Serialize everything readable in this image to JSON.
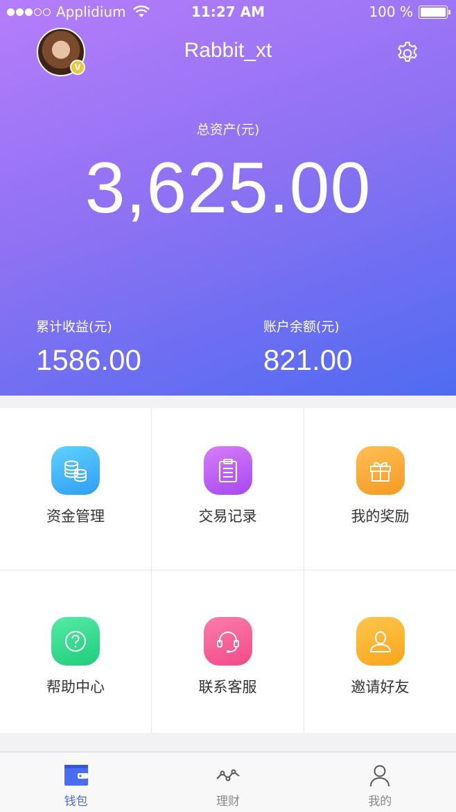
{
  "status_bar": {
    "carrier": "Applidium",
    "time": "11:27 AM",
    "battery": "100 %"
  },
  "header": {
    "username": "Rabbit_xt",
    "vip_badge": "V"
  },
  "assets": {
    "total_label": "总资产(元)",
    "total_value": "3,625.00",
    "earnings_label": "累计收益(元)",
    "earnings_value": "1586.00",
    "balance_label": "账户余额(元)",
    "balance_value": "821.00"
  },
  "menu": [
    {
      "label": "资金管理",
      "icon": "coins-icon",
      "color_from": "#5fd2fb",
      "color_to": "#2f9df6"
    },
    {
      "label": "交易记录",
      "icon": "clipboard-icon",
      "color_from": "#d77df9",
      "color_to": "#a648f0"
    },
    {
      "label": "我的奖励",
      "icon": "gift-icon",
      "color_from": "#ffbf55",
      "color_to": "#f59a22"
    },
    {
      "label": "帮助中心",
      "icon": "help-icon",
      "color_from": "#55eba6",
      "color_to": "#1dcd7a"
    },
    {
      "label": "联系客服",
      "icon": "headset-icon",
      "color_from": "#fb7dab",
      "color_to": "#f44a87"
    },
    {
      "label": "邀请好友",
      "icon": "user-icon",
      "color_from": "#ffc74d",
      "color_to": "#f8a41a"
    }
  ],
  "tabs": [
    {
      "label": "钱包",
      "icon": "wallet-icon",
      "active": true
    },
    {
      "label": "理财",
      "icon": "chart-line-icon",
      "active": false
    },
    {
      "label": "我的",
      "icon": "person-icon",
      "active": false
    }
  ],
  "colors": {
    "accent": "#4a6cf0",
    "gradient_start": "#b57dfb",
    "gradient_end": "#4f6bf1"
  }
}
